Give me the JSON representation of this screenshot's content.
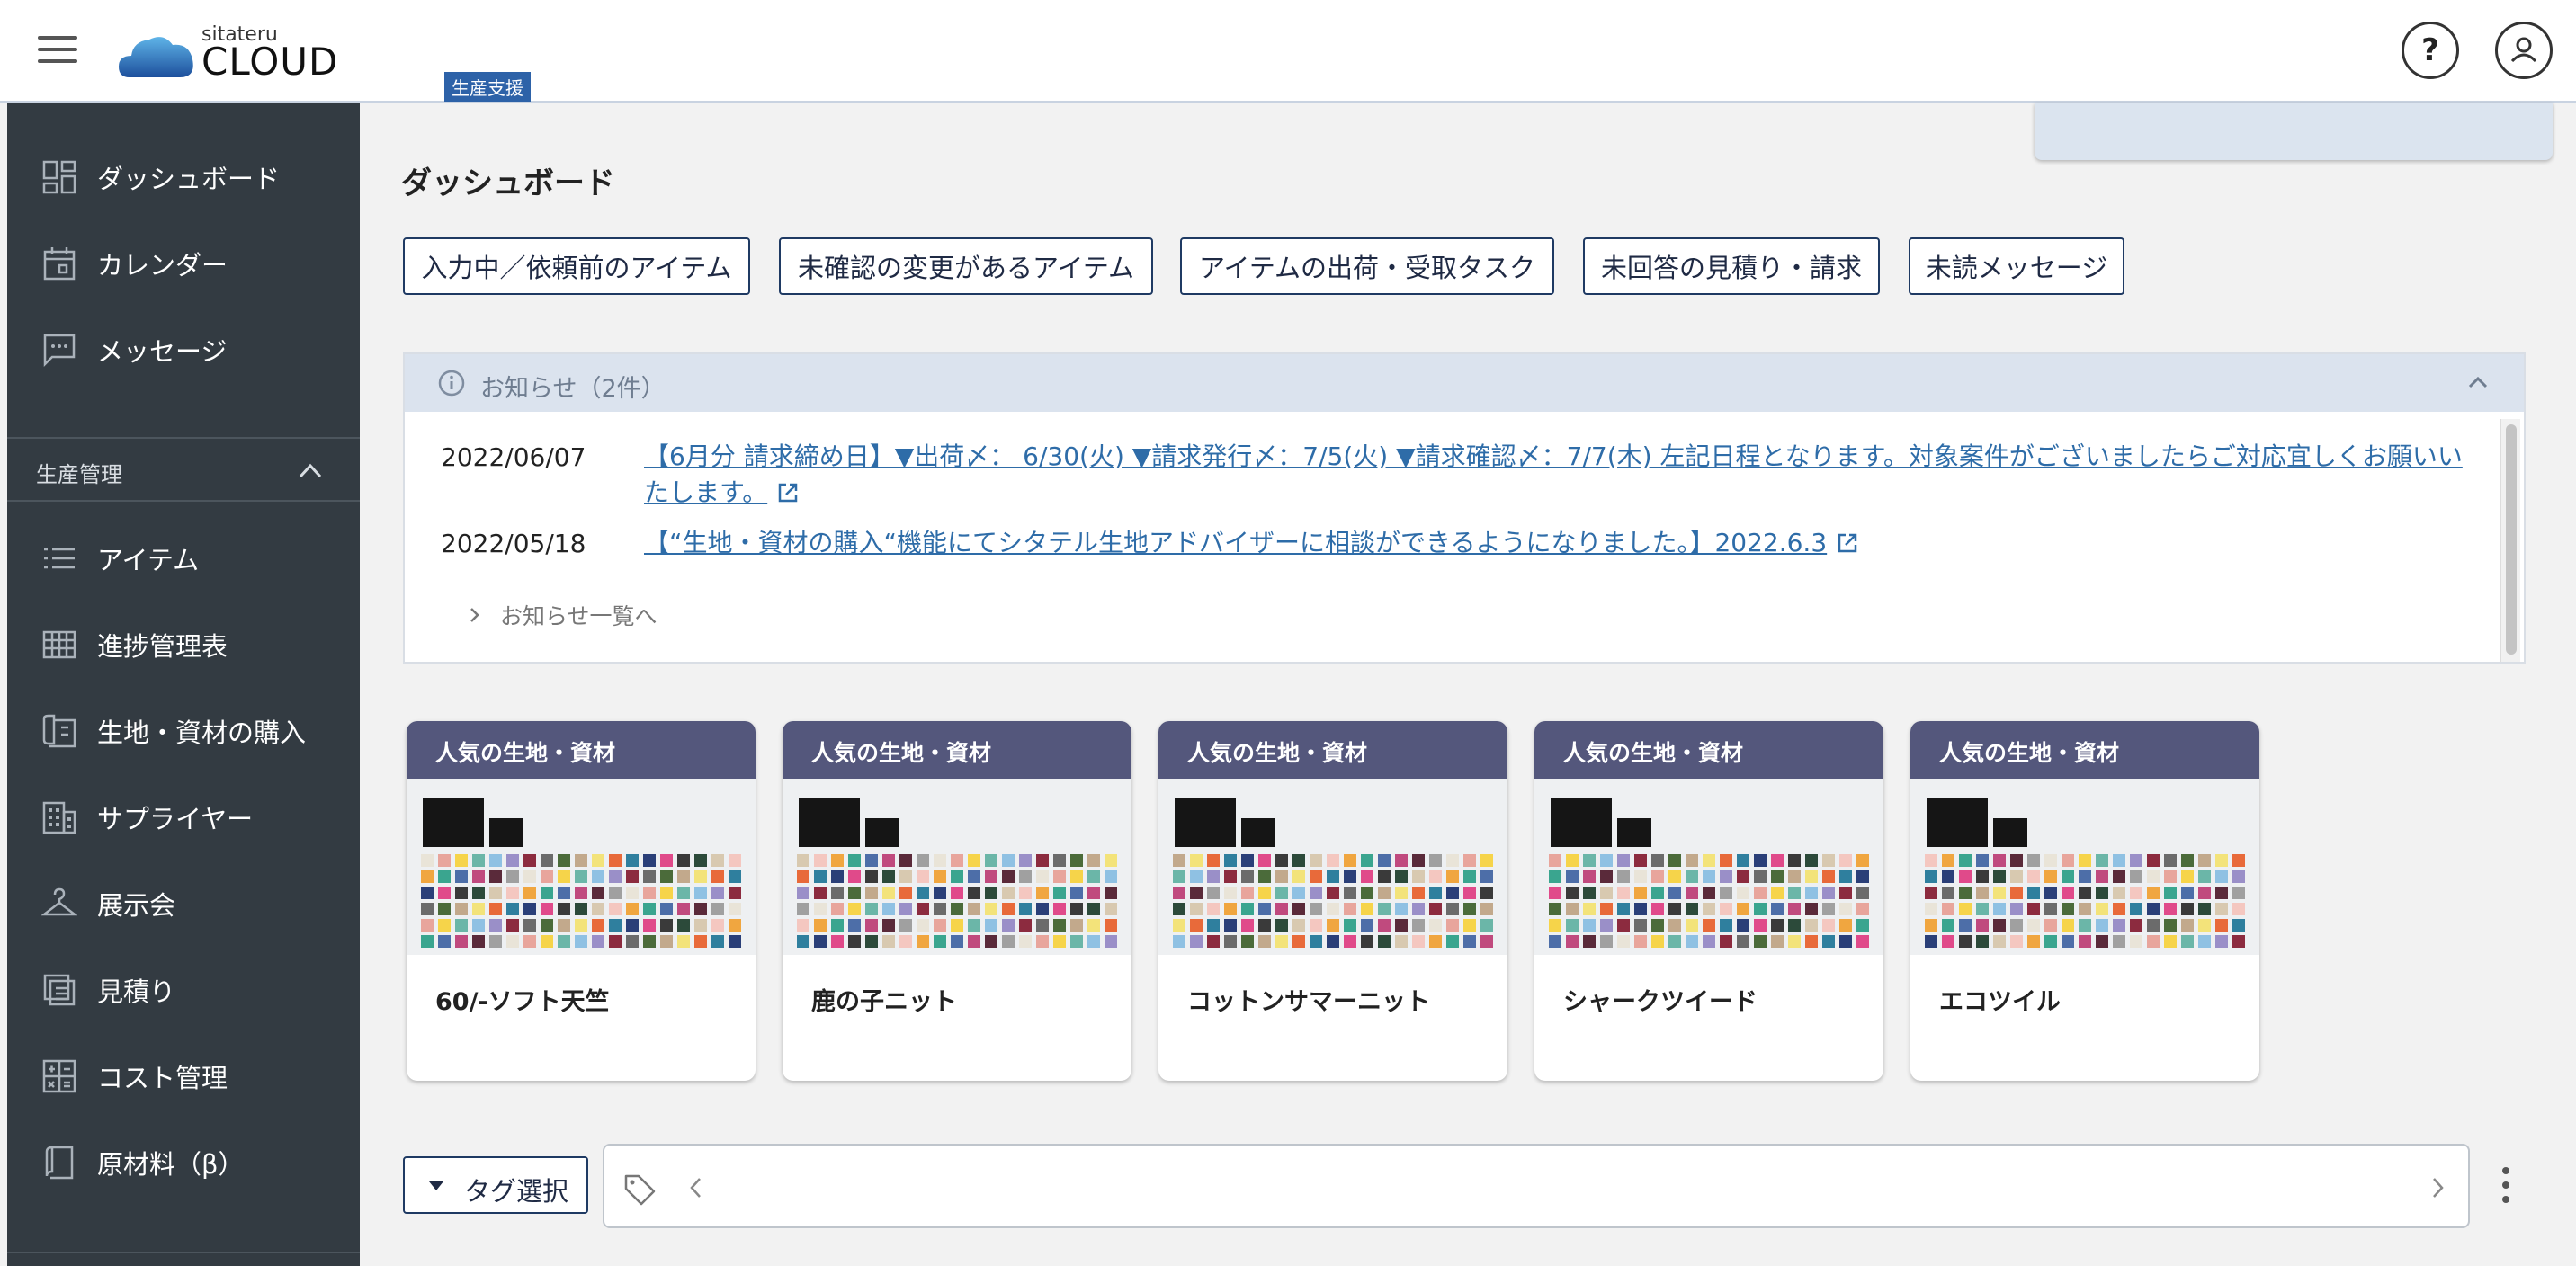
{
  "header": {
    "logo_small": "sitateru",
    "logo_main": "CLOUD",
    "logo_badge": "生産支援",
    "help_label": "?"
  },
  "sidebar": {
    "top_items": [
      {
        "label": "ダッシュボード",
        "icon": "dashboard-icon"
      },
      {
        "label": "カレンダー",
        "icon": "calendar-icon"
      },
      {
        "label": "メッセージ",
        "icon": "message-icon"
      }
    ],
    "section_label": "生産管理",
    "section_items": [
      {
        "label": "アイテム",
        "icon": "list-icon"
      },
      {
        "label": "進捗管理表",
        "icon": "grid-table-icon"
      },
      {
        "label": "生地・資材の購入",
        "icon": "fabric-icon"
      },
      {
        "label": "サプライヤー",
        "icon": "building-icon"
      },
      {
        "label": "展示会",
        "icon": "hanger-icon"
      },
      {
        "label": "見積り",
        "icon": "estimate-icon"
      },
      {
        "label": "コスト管理",
        "icon": "calculator-icon"
      },
      {
        "label": "原材料（β）",
        "icon": "book-icon"
      }
    ]
  },
  "main": {
    "title": "ダッシュボード",
    "quick_buttons": [
      "入力中／依頼前のアイテム",
      "未確認の変更があるアイテム",
      "アイテムの出荷・受取タスク",
      "未回答の見積り・請求",
      "未読メッセージ"
    ],
    "notice": {
      "title": "お知らせ（2件）",
      "items": [
        {
          "date": "2022/06/07",
          "text": "【6月分 請求締め日】▼出荷〆： 6/30(火) ▼請求発行〆：7/5(火) ▼請求確認〆：7/7(木) 左記日程となります。対象案件がございましたらご対応宜しくお願いいたします。"
        },
        {
          "date": "2022/05/18",
          "text": "【“生地・資材の購入“機能にてシタテル生地アドバイザーに相談ができるようになりました。】2022.6.3"
        }
      ],
      "more_label": "お知らせ一覧へ"
    },
    "cards": [
      {
        "header": "人気の生地・資材",
        "name": "60/-ソフト天竺"
      },
      {
        "header": "人気の生地・資材",
        "name": "鹿の子ニット"
      },
      {
        "header": "人気の生地・資材",
        "name": "コットンサマーニット"
      },
      {
        "header": "人気の生地・資材",
        "name": "シャークツイード"
      },
      {
        "header": "人気の生地・資材",
        "name": "エコツイル"
      }
    ],
    "tag_select_label": "タグ選択"
  },
  "colors": {
    "sidebar_bg": "#333b42",
    "card_header_bg": "#54577c",
    "link": "#2e6ca8",
    "button_border": "#1f3a63",
    "notice_header_bg": "#dbe3ee"
  }
}
